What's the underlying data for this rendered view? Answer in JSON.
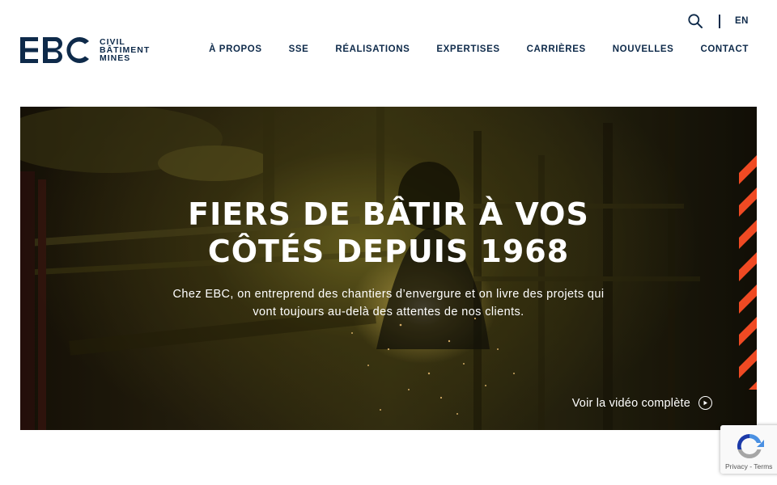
{
  "header": {
    "logo": {
      "mark_text": "EBC",
      "words": [
        "CIVIL",
        "BÂTIMENT",
        "MINES"
      ]
    },
    "utility": {
      "search_icon": "search-icon",
      "language_link": "EN"
    },
    "nav": [
      {
        "label": "À PROPOS"
      },
      {
        "label": "SSE"
      },
      {
        "label": "RÉALISATIONS"
      },
      {
        "label": "EXPERTISES"
      },
      {
        "label": "CARRIÈRES"
      },
      {
        "label": "NOUVELLES"
      },
      {
        "label": "CONTACT"
      }
    ]
  },
  "hero": {
    "title_lines": [
      "FIERS DE BÂTIR À VOS",
      "CÔTÉS DEPUIS 1968"
    ],
    "subtitle_lines": [
      "Chez EBC, on entreprend des chantiers d’envergure et on livre des projets qui",
      "vont toujours au-delà des attentes de nos clients."
    ],
    "video_link": "Voir la vidéo complète",
    "video_icon": "play-circle-icon",
    "accent_color": "#f04a23"
  },
  "recaptcha": {
    "links": "Privacy - Terms"
  },
  "colors": {
    "brand_navy": "#0e2a4a",
    "accent_orange": "#f04a23",
    "background": "#ffffff"
  }
}
